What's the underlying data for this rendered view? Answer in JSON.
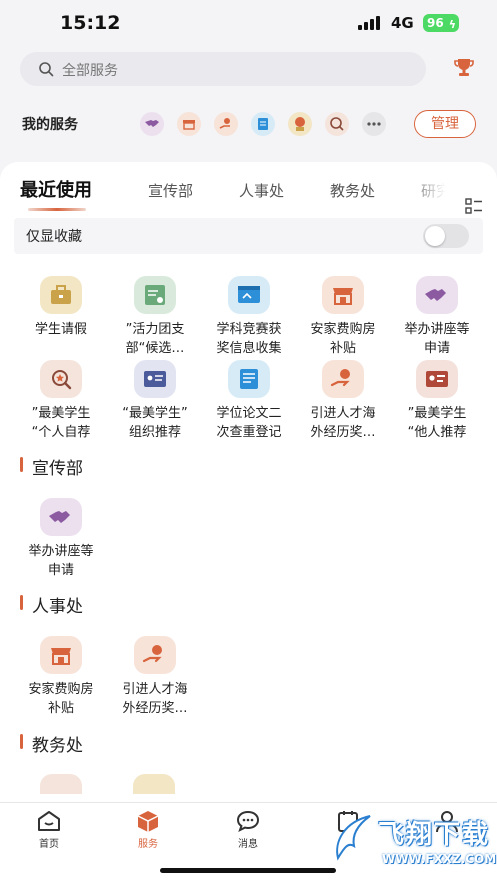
{
  "status_bar": {
    "time": "15:12",
    "network": "4G",
    "battery": "96"
  },
  "search": {
    "placeholder": "全部服务"
  },
  "my_services": {
    "label": "我的服务",
    "manage_label": "管理",
    "icons": [
      "handshake-icon",
      "storefront-icon",
      "hand-coin-icon",
      "certificate-icon",
      "medal-icon",
      "search-star-icon",
      "more-icon"
    ]
  },
  "tabs": [
    "最近使用",
    "宣传部",
    "人事处",
    "教务处",
    "研究"
  ],
  "favorites_toggle": {
    "label": "仅显收藏",
    "on": false
  },
  "recent_items": [
    {
      "label": "学生请假",
      "icon": "briefcase-icon",
      "color": "#f3e6c5"
    },
    {
      "label": "”活力团支\n部“候选…",
      "icon": "certificate-icon",
      "color": "#d9eadc"
    },
    {
      "label": "学科竞赛获\n奖信息收集",
      "icon": "browser-icon",
      "color": "#d7ebf7"
    },
    {
      "label": "安家费购房\n补贴",
      "icon": "storefront-icon",
      "color": "#f7e3d8"
    },
    {
      "label": "举办讲座等\n申请",
      "icon": "handshake-icon",
      "color": "#ece0ef"
    },
    {
      "label": "”最美学生\n“个人自荐",
      "icon": "search-star-icon",
      "color": "#f4e4dc"
    },
    {
      "label": "“最美学生”\n组织推荐",
      "icon": "id-card-icon",
      "color": "#e2e4f2"
    },
    {
      "label": "学位论文二\n次查重登记",
      "icon": "scroll-icon",
      "color": "#d7ebf7"
    },
    {
      "label": "引进人才海\n外经历奖…",
      "icon": "hand-coin-icon",
      "color": "#f7e3d8"
    },
    {
      "label": "”最美学生\n“他人推荐",
      "icon": "contact-card-icon",
      "color": "#f4e1dc"
    }
  ],
  "sections": [
    {
      "title": "宣传部",
      "items": [
        {
          "label": "举办讲座等\n申请",
          "icon": "handshake-icon",
          "color": "#ece0ef"
        }
      ]
    },
    {
      "title": "人事处",
      "items": [
        {
          "label": "安家费购房\n补贴",
          "icon": "storefront-icon",
          "color": "#f7e3d8"
        },
        {
          "label": "引进人才海\n外经历奖…",
          "icon": "hand-coin-icon",
          "color": "#f7e3d8"
        }
      ]
    },
    {
      "title": "教务处",
      "items": []
    }
  ],
  "bottom_nav": [
    {
      "label": "首页",
      "icon": "home-icon",
      "active": false
    },
    {
      "label": "服务",
      "icon": "cube-icon",
      "active": true
    },
    {
      "label": "消息",
      "icon": "chat-icon",
      "active": false
    },
    {
      "label": "",
      "icon": "calendar-icon",
      "active": false
    },
    {
      "label": "",
      "icon": "person-icon",
      "active": false
    }
  ],
  "watermark": {
    "title": "飞翔下载",
    "url": "WWW.FXXZ.COM"
  },
  "colors": {
    "accent": "#d8643e",
    "background": "#f4f4f6"
  }
}
